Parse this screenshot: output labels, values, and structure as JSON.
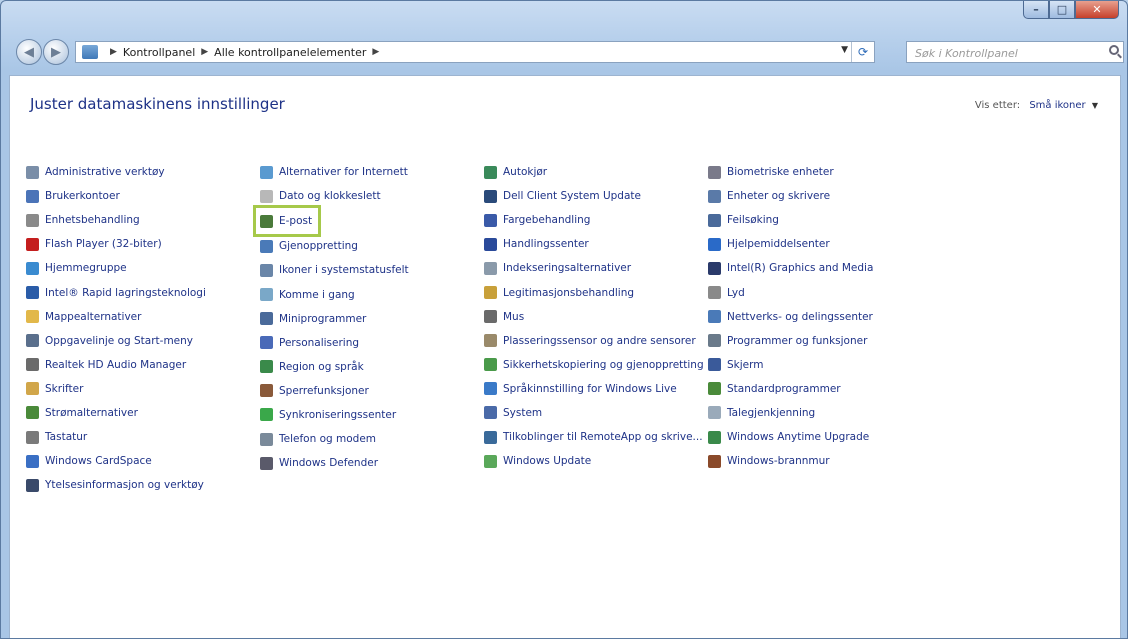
{
  "address": {
    "crumbs": [
      "Kontrollpanel",
      "Alle kontrollpanelelementer"
    ]
  },
  "search": {
    "placeholder": "Søk i Kontrollpanel"
  },
  "page": {
    "title": "Juster datamaskinens innstillinger",
    "view_by_label": "Vis etter:",
    "view_by_value": "Små ikoner"
  },
  "columns": [
    {
      "items": [
        {
          "label": "Administrative verktøy",
          "icon": "admin-tools-icon",
          "color": "#7a8ea8"
        },
        {
          "label": "Brukerkontoer",
          "icon": "user-accounts-icon",
          "color": "#4b74b8"
        },
        {
          "label": "Enhetsbehandling",
          "icon": "device-manager-icon",
          "color": "#8a8a8a"
        },
        {
          "label": "Flash Player (32-biter)",
          "icon": "flash-player-icon",
          "color": "#c41e1e"
        },
        {
          "label": "Hjemmegruppe",
          "icon": "homegroup-icon",
          "color": "#3a8bd0"
        },
        {
          "label": "Intel® Rapid lagringsteknologi",
          "icon": "intel-rapid-storage-icon",
          "color": "#2a5ca8"
        },
        {
          "label": "Mappealternativer",
          "icon": "folder-options-icon",
          "color": "#e2b84a"
        },
        {
          "label": "Oppgavelinje og Start-meny",
          "icon": "taskbar-icon",
          "color": "#5a6f8c"
        },
        {
          "label": "Realtek HD Audio Manager",
          "icon": "realtek-audio-icon",
          "color": "#6b6b6b"
        },
        {
          "label": "Skrifter",
          "icon": "fonts-icon",
          "color": "#d1a64a"
        },
        {
          "label": "Strømalternativer",
          "icon": "power-options-icon",
          "color": "#4a8a3a"
        },
        {
          "label": "Tastatur",
          "icon": "keyboard-icon",
          "color": "#7a7a7a"
        },
        {
          "label": "Windows CardSpace",
          "icon": "cardspace-icon",
          "color": "#3a6fc4"
        },
        {
          "label": "Ytelsesinformasjon og verktøy",
          "icon": "performance-icon",
          "color": "#3a4a6a"
        }
      ]
    },
    {
      "items": [
        {
          "label": "Alternativer for Internett",
          "icon": "internet-options-icon",
          "color": "#5a9ad0"
        },
        {
          "label": "Dato og klokkeslett",
          "icon": "date-time-icon",
          "color": "#b8b8b8"
        },
        {
          "label": "E-post",
          "icon": "mail-icon",
          "color": "#4a7a3a",
          "highlight": true
        },
        {
          "label": "Gjenoppretting",
          "icon": "recovery-icon",
          "color": "#4a7ab8"
        },
        {
          "label": "Ikoner i systemstatusfelt",
          "icon": "notification-icons-icon",
          "color": "#6a86a8"
        },
        {
          "label": "Komme i gang",
          "icon": "getting-started-icon",
          "color": "#7aa8c8"
        },
        {
          "label": "Miniprogrammer",
          "icon": "gadgets-icon",
          "color": "#4a6a9a"
        },
        {
          "label": "Personalisering",
          "icon": "personalization-icon",
          "color": "#4a6ab8"
        },
        {
          "label": "Region og språk",
          "icon": "region-language-icon",
          "color": "#3a8a4a"
        },
        {
          "label": "Sperrefunksjoner",
          "icon": "parental-controls-icon",
          "color": "#8a5a3a"
        },
        {
          "label": "Synkroniseringssenter",
          "icon": "sync-center-icon",
          "color": "#3aa84a"
        },
        {
          "label": "Telefon og modem",
          "icon": "phone-modem-icon",
          "color": "#7a8a9a"
        },
        {
          "label": "Windows Defender",
          "icon": "defender-icon",
          "color": "#5a5a6a"
        }
      ]
    },
    {
      "items": [
        {
          "label": "Autokjør",
          "icon": "autoplay-icon",
          "color": "#3a8a5a"
        },
        {
          "label": "Dell Client System Update",
          "icon": "dell-update-icon",
          "color": "#2a4a7a"
        },
        {
          "label": "Fargebehandling",
          "icon": "color-management-icon",
          "color": "#3a5aa8"
        },
        {
          "label": "Handlingssenter",
          "icon": "action-center-icon",
          "color": "#2a4a9a"
        },
        {
          "label": "Indekseringsalternativer",
          "icon": "indexing-icon",
          "color": "#8a9aaa"
        },
        {
          "label": "Legitimasjonsbehandling",
          "icon": "credential-manager-icon",
          "color": "#c8a03a"
        },
        {
          "label": "Mus",
          "icon": "mouse-icon",
          "color": "#6a6a6a"
        },
        {
          "label": "Plasseringssensor og andre sensorer",
          "icon": "location-sensor-icon",
          "color": "#9a8a6a"
        },
        {
          "label": "Sikkerhetskopiering og gjenoppretting",
          "icon": "backup-icon",
          "color": "#4a9a4a"
        },
        {
          "label": "Språkinnstilling for Windows Live",
          "icon": "windows-live-language-icon",
          "color": "#3a7ac8"
        },
        {
          "label": "System",
          "icon": "system-icon",
          "color": "#4a6aa8"
        },
        {
          "label": "Tilkoblinger til RemoteApp og skrive...",
          "icon": "remoteapp-icon",
          "color": "#3a6a9a"
        },
        {
          "label": "Windows Update",
          "icon": "windows-update-icon",
          "color": "#5aa85a"
        }
      ]
    },
    {
      "items": [
        {
          "label": "Biometriske enheter",
          "icon": "biometric-icon",
          "color": "#7a7a8a"
        },
        {
          "label": "Enheter og skrivere",
          "icon": "devices-printers-icon",
          "color": "#5a7aa8"
        },
        {
          "label": "Feilsøking",
          "icon": "troubleshooting-icon",
          "color": "#4a6a9a"
        },
        {
          "label": "Hjelpemiddelsenter",
          "icon": "ease-of-access-icon",
          "color": "#2a6ac8"
        },
        {
          "label": "Intel(R) Graphics and Media",
          "icon": "intel-graphics-icon",
          "color": "#2a3a6a"
        },
        {
          "label": "Lyd",
          "icon": "sound-icon",
          "color": "#8a8a8a"
        },
        {
          "label": "Nettverks- og delingssenter",
          "icon": "network-sharing-icon",
          "color": "#4a7ab8"
        },
        {
          "label": "Programmer og funksjoner",
          "icon": "programs-features-icon",
          "color": "#6a7a8a"
        },
        {
          "label": "Skjerm",
          "icon": "display-icon",
          "color": "#3a5a9a"
        },
        {
          "label": "Standardprogrammer",
          "icon": "default-programs-icon",
          "color": "#4a8a3a"
        },
        {
          "label": "Talegjenkjenning",
          "icon": "speech-recognition-icon",
          "color": "#9aaaba"
        },
        {
          "label": "Windows Anytime Upgrade",
          "icon": "anytime-upgrade-icon",
          "color": "#3a8a4a"
        },
        {
          "label": "Windows-brannmur",
          "icon": "firewall-icon",
          "color": "#8a4a2a"
        }
      ]
    }
  ]
}
